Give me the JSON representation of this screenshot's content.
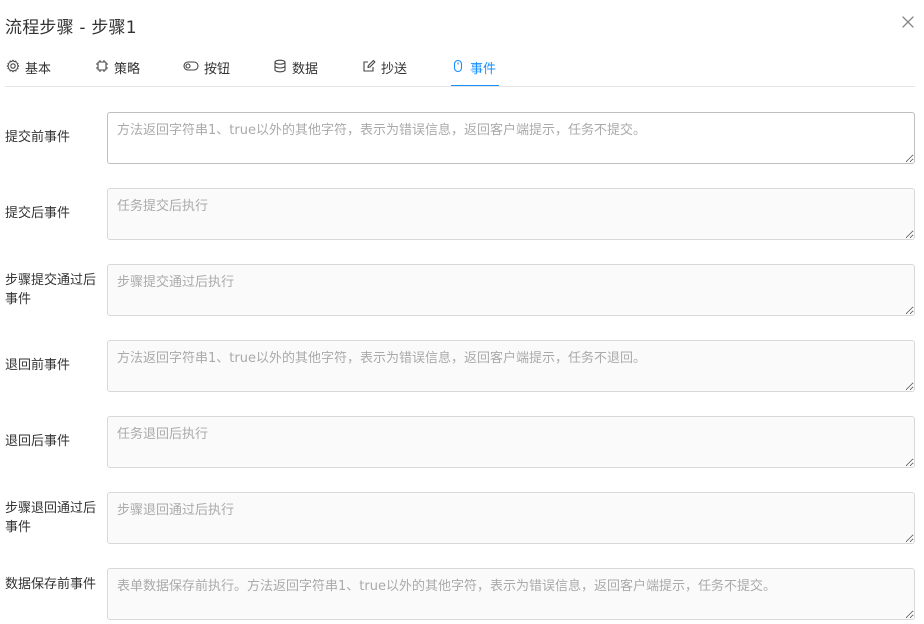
{
  "dialog": {
    "title": "流程步骤 - 步骤1"
  },
  "tabs": [
    {
      "label": "基本",
      "icon": "gear-icon"
    },
    {
      "label": "策略",
      "icon": "chip-icon"
    },
    {
      "label": "按钮",
      "icon": "toggle-icon"
    },
    {
      "label": "数据",
      "icon": "database-icon"
    },
    {
      "label": "抄送",
      "icon": "edit-icon"
    },
    {
      "label": "事件",
      "icon": "mouse-icon",
      "active": true
    }
  ],
  "accent_color": "#1890ff",
  "events": [
    {
      "label": "提交前事件",
      "value": "",
      "placeholder": "方法返回字符串1、true以外的其他字符，表示为错误信息，返回客户端提示，任务不提交。"
    },
    {
      "label": "提交后事件",
      "value": "",
      "placeholder": "任务提交后执行"
    },
    {
      "label": "步骤提交通过后事件",
      "value": "",
      "placeholder": "步骤提交通过后执行"
    },
    {
      "label": "退回前事件",
      "value": "",
      "placeholder": "方法返回字符串1、true以外的其他字符，表示为错误信息，返回客户端提示，任务不退回。"
    },
    {
      "label": "退回后事件",
      "value": "",
      "placeholder": "任务退回后执行"
    },
    {
      "label": "步骤退回通过后事件",
      "value": "",
      "placeholder": "步骤退回通过后执行"
    },
    {
      "label": "数据保存前事件",
      "value": "",
      "placeholder": "表单数据保存前执行。方法返回字符串1、true以外的其他字符，表示为错误信息，返回客户端提示，任务不提交。"
    }
  ]
}
